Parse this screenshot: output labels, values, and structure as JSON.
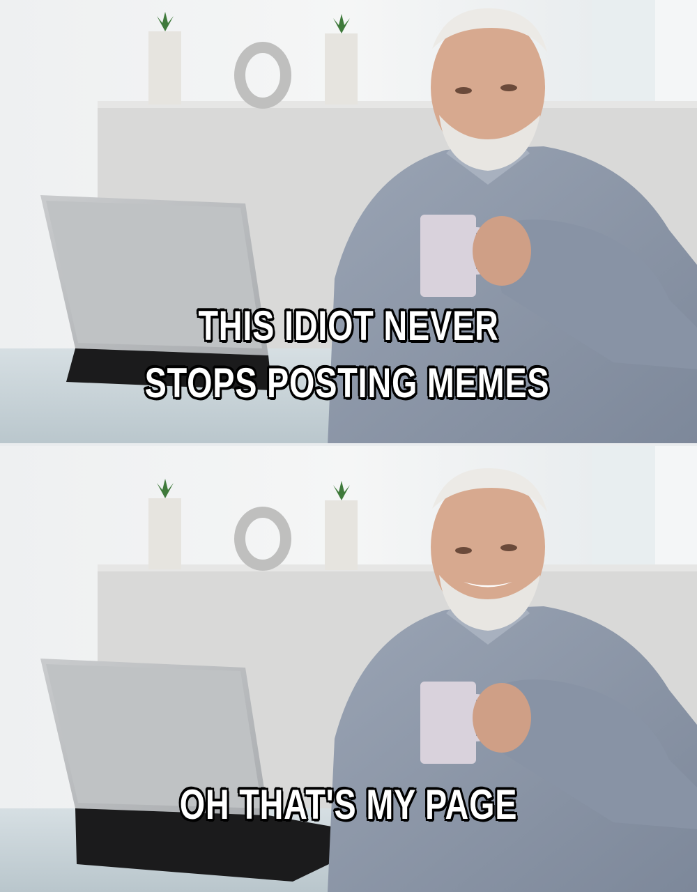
{
  "meme": {
    "top_caption": {
      "line1": "THIS IDIOT NEVER",
      "line2": "STOPS POSTING MEMES"
    },
    "bottom_caption": "OH THAT'S MY PAGE"
  },
  "colors": {
    "caption_text": "#ffffff",
    "caption_outline": "#000000",
    "shirt": "#8c97a8",
    "wall": "#dcdcdc",
    "desk": "#c9d4d9"
  }
}
